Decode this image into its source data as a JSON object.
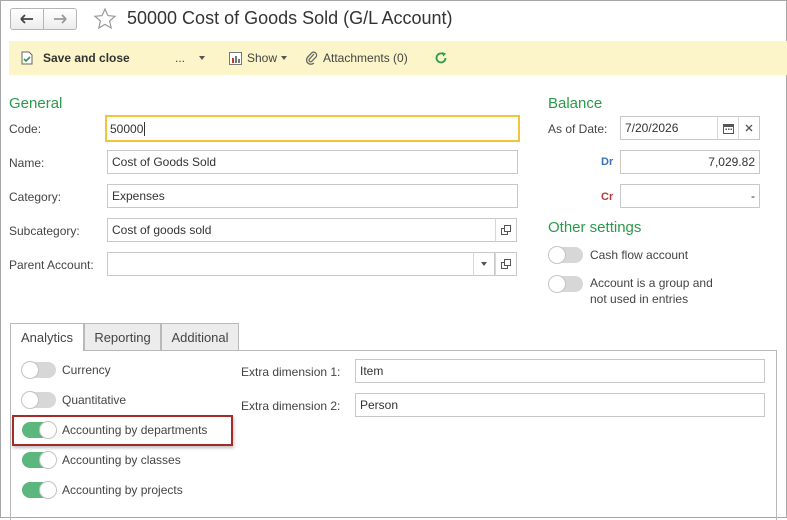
{
  "window": {
    "title": "50000 Cost of Goods Sold (G/L Account)"
  },
  "toolbar": {
    "save_close": "Save and close",
    "more": "...",
    "show": "Show",
    "attachments": "Attachments (0)"
  },
  "general": {
    "section_title": "General",
    "code_label": "Code:",
    "code_value": "50000",
    "name_label": "Name:",
    "name_value": "Cost of Goods Sold",
    "category_label": "Category:",
    "category_value": "Expenses",
    "subcategory_label": "Subcategory:",
    "subcategory_value": "Cost of goods sold",
    "parent_label": "Parent Account:",
    "parent_value": ""
  },
  "balance": {
    "section_title": "Balance",
    "as_of_label": "As of Date:",
    "as_of_value": "7/20/2026",
    "dr_label": "Dr",
    "dr_value": "7,029.82",
    "cr_label": "Cr",
    "cr_value": "-"
  },
  "other_settings": {
    "section_title": "Other settings",
    "cash_flow": {
      "label": "Cash flow account",
      "on": false
    },
    "group_line1": "Account is a group and",
    "group_line2": "not used in entries",
    "group_on": false
  },
  "tabs": [
    "Analytics",
    "Reporting",
    "Additional"
  ],
  "analytics": {
    "toggles": [
      {
        "label": "Currency",
        "on": false
      },
      {
        "label": "Quantitative",
        "on": false
      },
      {
        "label": "Accounting by departments",
        "on": true
      },
      {
        "label": "Accounting by classes",
        "on": true
      },
      {
        "label": "Accounting by projects",
        "on": true
      }
    ],
    "extra1_label": "Extra dimension 1:",
    "extra1_value": "Item",
    "extra2_label": "Extra dimension 2:",
    "extra2_value": "Person"
  },
  "colors": {
    "accent_green": "#2a9a4a",
    "toolbar_bg": "#fbf5c9",
    "toggle_on": "#5bb77d",
    "focus_border": "#f0c43c",
    "highlight_border": "#a52a2a"
  }
}
